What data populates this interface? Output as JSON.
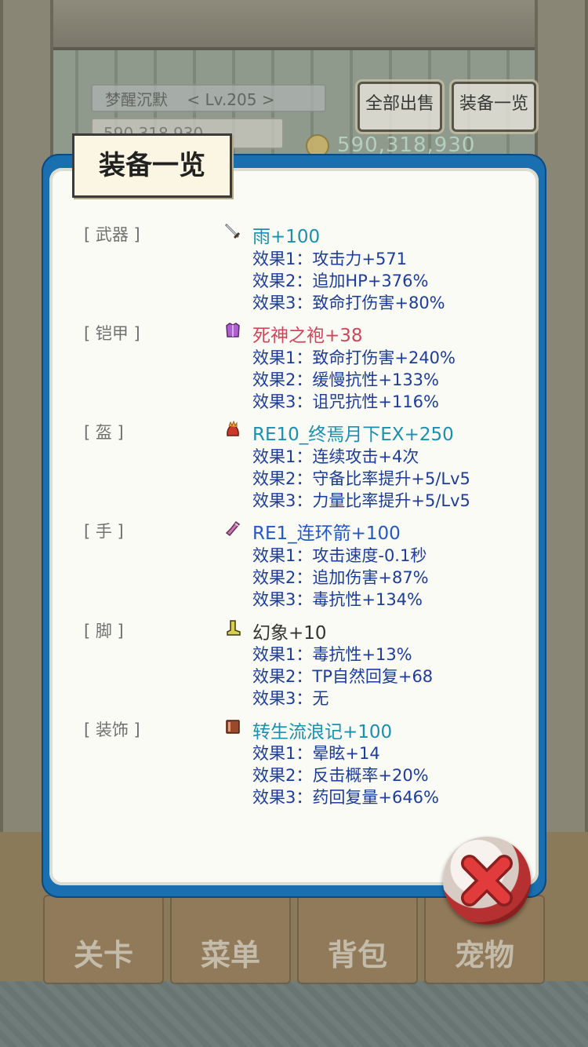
{
  "hud": {
    "player_name": "梦醒沉默",
    "player_level": "< Lv.205 >",
    "gold_small": "590,318,930",
    "sell_all_label": "全部出售",
    "equipment_list_label": "装备一览",
    "gold": "590,318,930"
  },
  "tabs": [
    {
      "label": "关卡"
    },
    {
      "label": "菜单"
    },
    {
      "label": "背包"
    },
    {
      "label": "宠物"
    }
  ],
  "dialog": {
    "title": "装备一览",
    "slots": [
      {
        "slot": "[ 武器 ]",
        "item": "雨+100",
        "item_color": "#1a8fb0",
        "icon": "sword-icon",
        "effects": [
          "效果1：攻击力+571",
          "效果2：追加HP+376%",
          "效果3：致命打伤害+80%"
        ]
      },
      {
        "slot": "[ 铠甲 ]",
        "item": "死神之袍+38",
        "item_color": "#d0465a",
        "icon": "armor-icon",
        "effects": [
          "效果1：致命打伤害+240%",
          "效果2：缓慢抗性+133%",
          "效果3：诅咒抗性+116%"
        ]
      },
      {
        "slot": "[ 盔 ]",
        "item": "RE10_终焉月下EX+250",
        "item_color": "#1a8fb0",
        "icon": "helmet-icon",
        "effects": [
          "效果1：连续攻击+4次",
          "效果2：守备比率提升+5/Lv5",
          "效果3：力量比率提升+5/Lv5"
        ]
      },
      {
        "slot": "[ 手 ]",
        "item": "RE1_连环箭+100",
        "item_color": "#2457c8",
        "icon": "glove-icon",
        "effects": [
          "效果1：攻击速度-0.1秒",
          "效果2：追加伤害+87%",
          "效果3：毒抗性+134%"
        ]
      },
      {
        "slot": "[ 脚 ]",
        "item": "幻象+10",
        "item_color": "#333333",
        "icon": "boot-icon",
        "effects": [
          "效果1：毒抗性+13%",
          "效果2：TP自然回复+68",
          "效果3：无"
        ]
      },
      {
        "slot": "[ 装饰 ]",
        "item": "转生流浪记+100",
        "item_color": "#1a8fb0",
        "icon": "book-icon",
        "effects": [
          "效果1：晕眩+14",
          "效果2：反击概率+20%",
          "效果3：药回复量+646%"
        ]
      }
    ]
  },
  "colors": {
    "dialog_border": "#1a6fb0",
    "effect_text": "#1c3d9a",
    "close_red": "#b53131"
  }
}
